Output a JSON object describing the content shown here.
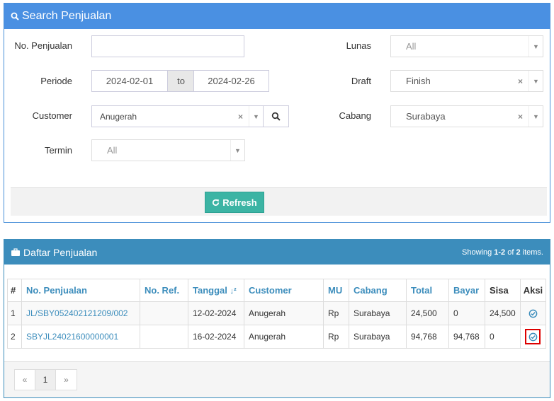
{
  "search_panel": {
    "title": "Search Penjualan",
    "no_penjualan_label": "No. Penjualan",
    "no_penjualan_value": "",
    "periode_label": "Periode",
    "periode_from": "2024-02-01",
    "periode_to_label": "to",
    "periode_to": "2024-02-26",
    "customer_label": "Customer",
    "customer_value": "Anugerah",
    "termin_label": "Termin",
    "termin_value": "All",
    "lunas_label": "Lunas",
    "lunas_value": "All",
    "draft_label": "Draft",
    "draft_value": "Finish",
    "cabang_label": "Cabang",
    "cabang_value": "Surabaya",
    "refresh_label": "Refresh"
  },
  "list_panel": {
    "title": "Daftar Penjualan",
    "summary_prefix": "Showing ",
    "summary_range": "1-2",
    "summary_mid": " of ",
    "summary_total": "2",
    "summary_suffix": " items.",
    "columns": [
      "#",
      "No. Penjualan",
      "No. Ref.",
      "Tanggal",
      "Customer",
      "MU",
      "Cabang",
      "Total",
      "Bayar",
      "Sisa",
      "Aksi"
    ],
    "rows": [
      {
        "no": "1",
        "no_penjualan": "JL/SBY052402121209/002",
        "no_ref": "",
        "tanggal": "12-02-2024",
        "customer": "Anugerah",
        "mu": "Rp",
        "cabang": "Surabaya",
        "total": "24,500",
        "bayar": "0",
        "sisa": "24,500"
      },
      {
        "no": "2",
        "no_penjualan": "SBYJL24021600000001",
        "no_ref": "",
        "tanggal": "16-02-2024",
        "customer": "Anugerah",
        "mu": "Rp",
        "cabang": "Surabaya",
        "total": "94,768",
        "bayar": "94,768",
        "sisa": "0"
      }
    ],
    "pager": {
      "prev": "«",
      "page": "1",
      "next": "»"
    }
  }
}
